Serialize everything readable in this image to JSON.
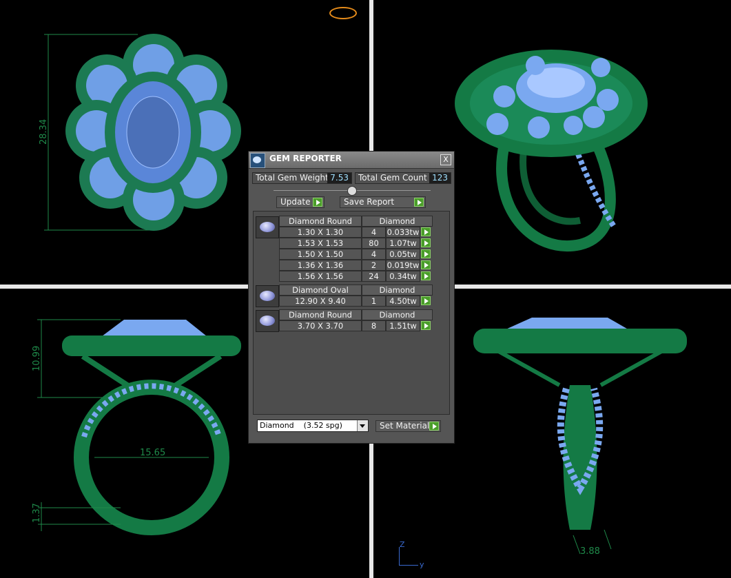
{
  "colors": {
    "metal": "#147a45",
    "gem": "#7aa8f0",
    "dimension": "#1f8a4a",
    "background": "#000000"
  },
  "viewports": {
    "top_left": {
      "name": "top view",
      "dimension": "28.34"
    },
    "top_right": {
      "name": "perspective view"
    },
    "bottom_left": {
      "name": "front view",
      "dimensions": [
        "10.99",
        "15.65",
        "1.37"
      ]
    },
    "bottom_right": {
      "name": "side view",
      "dimension": "3.88"
    }
  },
  "axis": {
    "z": "Z",
    "y": "y"
  },
  "gem_reporter": {
    "title": "GEM REPORTER",
    "close": "X",
    "total_weight_label": "Total Gem Weight",
    "total_weight_value": "7.53",
    "total_count_label": "Total Gem Count",
    "total_count_value": "123",
    "update_label": "Update",
    "save_report_label": "Save Report",
    "groups": [
      {
        "shape": "Diamond Round",
        "material": "Diamond",
        "icon": "round-gem-icon",
        "rows": [
          {
            "size": "1.30 X 1.30",
            "count": "4",
            "weight": "0.033tw"
          },
          {
            "size": "1.53 X 1.53",
            "count": "80",
            "weight": "1.07tw"
          },
          {
            "size": "1.50 X 1.50",
            "count": "4",
            "weight": "0.05tw"
          },
          {
            "size": "1.36 X 1.36",
            "count": "2",
            "weight": "0.019tw"
          },
          {
            "size": "1.56 X 1.56",
            "count": "24",
            "weight": "0.34tw"
          }
        ]
      },
      {
        "shape": "Diamond Oval",
        "material": "Diamond",
        "icon": "oval-gem-icon",
        "rows": [
          {
            "size": "12.90 X 9.40",
            "count": "1",
            "weight": "4.50tw"
          }
        ]
      },
      {
        "shape": "Diamond Round",
        "material": "Diamond",
        "icon": "round-gem-icon",
        "rows": [
          {
            "size": "3.70 X 3.70",
            "count": "8",
            "weight": "1.51tw"
          }
        ]
      }
    ],
    "material_select": "Diamond    (3.52 spg)",
    "set_material_label": "Set Material"
  }
}
